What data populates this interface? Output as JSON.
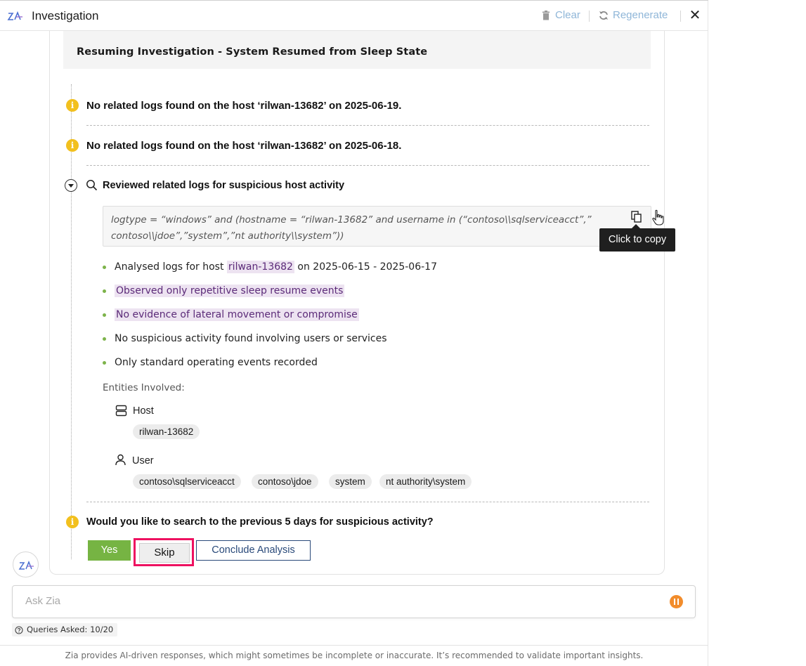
{
  "header": {
    "title": "Investigation",
    "clear_label": "Clear",
    "regenerate_label": "Regenerate",
    "close_label": "✕"
  },
  "banner": {
    "title": "Resuming Investigation - System Resumed from Sleep State"
  },
  "steps": [
    {
      "text": "No related logs found on the host ‘rilwan-13682’ on 2025-06-19."
    },
    {
      "text": "No related logs found on the host ‘rilwan-13682’ on 2025-06-18."
    }
  ],
  "review": {
    "title": "Reviewed related logs for suspicious host activity",
    "query_line1": "logtype = “windows” and (hostname = “rilwan-13682” and username in (“contoso\\\\sqlserviceacct”,”",
    "query_line2": "contoso\\\\jdoe”,”system”,”nt authority\\\\system”))",
    "tooltip": "Click to copy",
    "bullets": {
      "b1_prefix": "Analysed logs for host",
      "b1_host": "rilwan-13682",
      "b1_suffix": "on 2025-06-15 - 2025-06-17",
      "b2": "Observed only repetitive sleep resume events",
      "b3": "No evidence of lateral movement or compromise",
      "b4": "No suspicious activity found involving users or services",
      "b5": "Only standard operating events recorded"
    },
    "entities_label": "Entities Involved:",
    "host_label": "Host",
    "hosts": [
      "rilwan-13682"
    ],
    "user_label": "User",
    "users": [
      "contoso\\sqlserviceacct",
      "contoso\\jdoe",
      "system",
      "nt authority\\system"
    ]
  },
  "prompt": {
    "question": "Would you like to search to the previous 5 days for suspicious activity?",
    "yes_label": "Yes",
    "skip_label": "Skip",
    "conclude_label": "Conclude Analysis"
  },
  "input": {
    "placeholder": "Ask Zia"
  },
  "queries": {
    "text": "Queries Asked: 10/20"
  },
  "footer": {
    "disclaimer": "Zia provides AI-driven responses, which might sometimes be incomplete or inaccurate. It’s recommended to validate important insights."
  },
  "colors": {
    "accent_green": "#76b443",
    "highlight_purple": "#ede3f1",
    "warning_yellow": "#f2c01e",
    "skip_outline": "#ee1160",
    "pause_orange": "#f28c2b"
  },
  "icons": [
    "zia-logo-icon",
    "trash-icon",
    "refresh-icon",
    "close-icon",
    "info-icon",
    "expand-icon",
    "search-icon",
    "copy-icon",
    "hand-cursor-icon",
    "server-icon",
    "user-icon",
    "pause-icon",
    "question-icon"
  ]
}
